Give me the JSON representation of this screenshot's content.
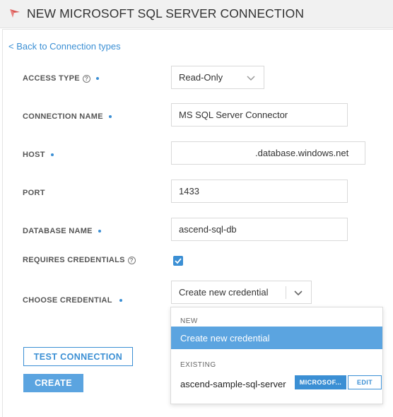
{
  "header": {
    "title": "NEW MICROSOFT SQL SERVER CONNECTION"
  },
  "nav": {
    "back_link": "< Back to Connection types"
  },
  "form": {
    "access_type": {
      "label": "ACCESS TYPE",
      "value": "Read-Only"
    },
    "connection_name": {
      "label": "CONNECTION NAME",
      "value": "MS SQL Server Connector"
    },
    "host": {
      "label": "HOST",
      "value": ".database.windows.net"
    },
    "port": {
      "label": "PORT",
      "value": "1433"
    },
    "database_name": {
      "label": "DATABASE NAME",
      "value": "ascend-sql-db"
    },
    "requires_credentials": {
      "label": "REQUIRES CREDENTIALS",
      "checked": true
    },
    "choose_credential": {
      "label": "CHOOSE CREDENTIAL",
      "value": "Create new credential"
    }
  },
  "dropdown": {
    "new_header": "NEW",
    "new_option": "Create new credential",
    "existing_header": "EXISTING",
    "existing_option": "ascend-sample-sql-server",
    "type_badge": "MICROSOF...",
    "edit_label": "EDIT"
  },
  "buttons": {
    "test_connection": "TEST CONNECTION",
    "create": "CREATE"
  },
  "colors": {
    "accent": "#3b8fd4",
    "accent_light": "#5ba4e0",
    "header_bg": "#f1f1f1",
    "logo": "#d9534f"
  },
  "icons": [
    "logo-icon",
    "help-icon",
    "chevron-down-icon",
    "checkmark-icon"
  ]
}
